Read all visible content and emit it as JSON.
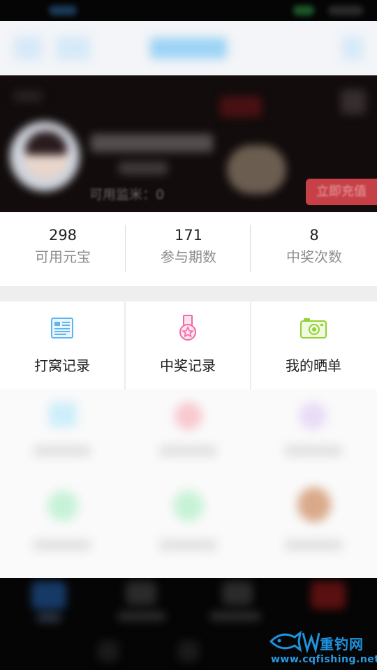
{
  "profile": {
    "rice_label": "可用监米：0",
    "recharge_label": "立即充值"
  },
  "stats": [
    {
      "value": "298",
      "label": "可用元宝"
    },
    {
      "value": "171",
      "label": "参与期数"
    },
    {
      "value": "8",
      "label": "中奖次数"
    }
  ],
  "menu": [
    {
      "label": "打窝记录",
      "icon": "document-list-icon"
    },
    {
      "label": "中奖记录",
      "icon": "medal-icon"
    },
    {
      "label": "我的晒单",
      "icon": "camera-icon"
    }
  ],
  "watermark": {
    "title": "重钓网",
    "url": "www.cqfishing.net"
  },
  "colors": {
    "recharge": "#c74048",
    "icon_blue": "#5fb5ec",
    "icon_pink": "#f06aa6",
    "icon_green": "#93d130",
    "watermark": "#1e93de"
  }
}
